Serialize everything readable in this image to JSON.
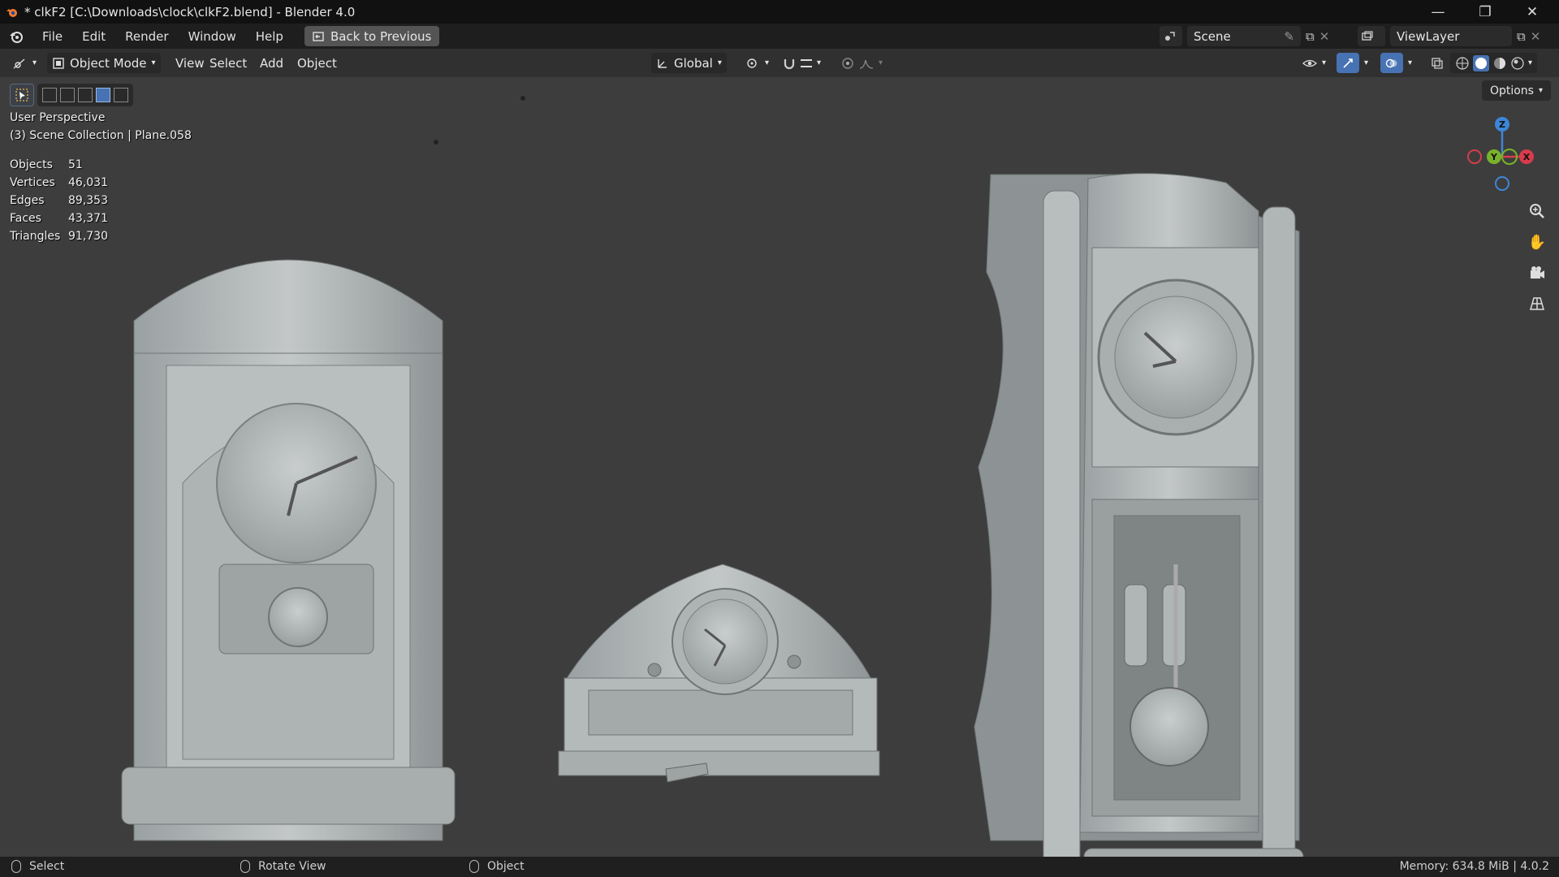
{
  "window": {
    "title": "* clkF2 [C:\\Downloads\\clock\\clkF2.blend] - Blender 4.0",
    "controls": [
      "minimize",
      "maximize",
      "close"
    ]
  },
  "menubar": {
    "items": [
      "File",
      "Edit",
      "Render",
      "Window",
      "Help"
    ],
    "back_button": "Back to Previous",
    "scene_label": "Scene",
    "view_layer_label": "ViewLayer"
  },
  "header": {
    "mode": "Object Mode",
    "menus": [
      "View",
      "Select",
      "Add",
      "Object"
    ],
    "orientation": "Global",
    "options_label": "Options"
  },
  "viewport": {
    "view_name": "User Perspective",
    "collection_line": "(3) Scene Collection | Plane.058",
    "stats": [
      {
        "label": "Objects",
        "value": "51"
      },
      {
        "label": "Vertices",
        "value": "46,031"
      },
      {
        "label": "Edges",
        "value": "89,353"
      },
      {
        "label": "Faces",
        "value": "43,371"
      },
      {
        "label": "Triangles",
        "value": "91,730"
      }
    ],
    "gizmo_axes": {
      "x": "X",
      "y": "Y",
      "z": "Z"
    }
  },
  "statusbar": {
    "left_action": "Select",
    "middle_action": "Rotate View",
    "right_action": "Object",
    "memory": "Memory: 634.8 MiB | 4.0.2"
  },
  "colors": {
    "accent": "#4772b3",
    "axis_x": "#d83c4c",
    "axis_y": "#79b22a",
    "axis_z": "#3d86d8"
  }
}
